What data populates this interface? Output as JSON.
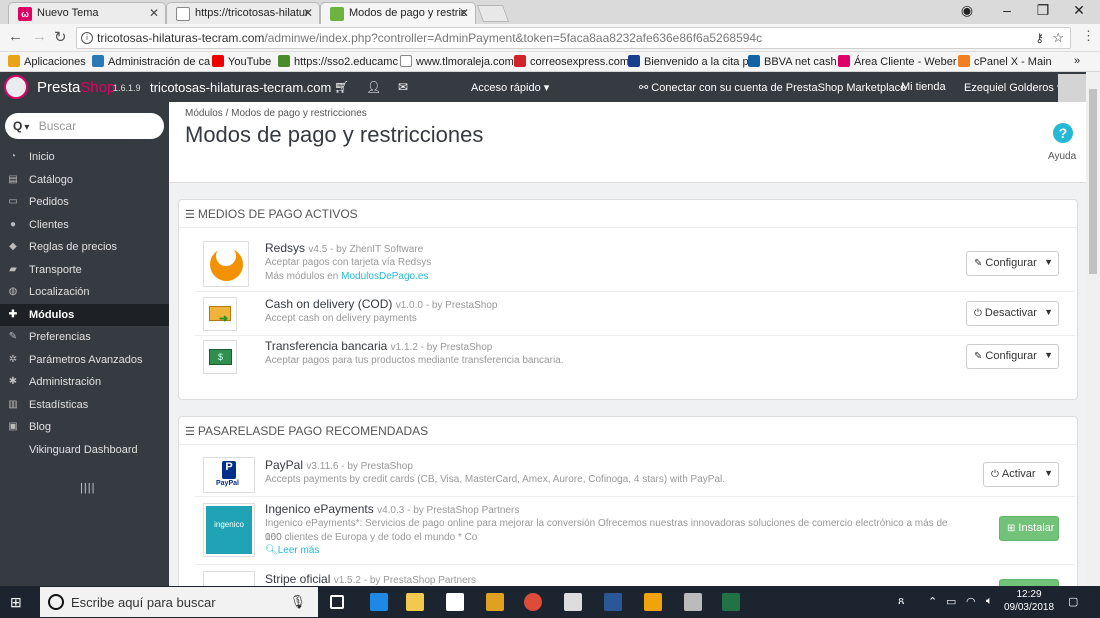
{
  "browser": {
    "tabs": [
      {
        "title": "Nuevo Tema",
        "favicon_color": "#df0067"
      },
      {
        "title": "https://tricotosas-hilatur",
        "favicon_color": "#ffffff"
      },
      {
        "title": "Modos de pago y restric",
        "favicon_color": "#6cb33f"
      }
    ],
    "url_main": "tricotosas-hilaturas-tecram.com",
    "url_rest": "/adminwe/index.php?controller=AdminPayment&token=5faca8aa8232afe636e86f6a5268594c",
    "bookmarks": [
      "Aplicaciones",
      "Administración de ca",
      "YouTube",
      "https://sso2.educamc",
      "www.tlmoraleja.com",
      "correosexpress.com",
      "Bienvenido a la cita p",
      "BBVA net cash",
      "Área Cliente - Weber",
      "cPanel X - Main"
    ]
  },
  "header": {
    "brand_presta": "Presta",
    "brand_shop": "Shop",
    "version": "1.6.1.9",
    "shop_name": "tricotosas-hilaturas-tecram.com",
    "quick_access": "Acceso rápido ▾",
    "connect": "Conectar con su cuenta de PrestaShop Marketplace",
    "my_shop": "Mi tienda",
    "user": "Ezequiel Golderos ▾"
  },
  "sidebar": {
    "search_placeholder": "Buscar",
    "items": [
      {
        "label": "Inicio",
        "icon": "dashboard-icon",
        "glyph": "◔"
      },
      {
        "label": "Catálogo",
        "icon": "book-icon",
        "glyph": "▤"
      },
      {
        "label": "Pedidos",
        "icon": "credit-card-icon",
        "glyph": "▭"
      },
      {
        "label": "Clientes",
        "icon": "users-icon",
        "glyph": "●"
      },
      {
        "label": "Reglas de precios",
        "icon": "tags-icon",
        "glyph": "◆"
      },
      {
        "label": "Transporte",
        "icon": "truck-icon",
        "glyph": "▰"
      },
      {
        "label": "Localización",
        "icon": "globe-icon",
        "glyph": "◍"
      },
      {
        "label": "Módulos",
        "icon": "puzzle-icon",
        "glyph": "✚"
      },
      {
        "label": "Preferencias",
        "icon": "wrench-icon",
        "glyph": "✎"
      },
      {
        "label": "Parámetros Avanzados",
        "icon": "cogs-icon",
        "glyph": "✲"
      },
      {
        "label": "Administración",
        "icon": "cog-icon",
        "glyph": "✱"
      },
      {
        "label": "Estadísticas",
        "icon": "bar-chart-icon",
        "glyph": "▥"
      },
      {
        "label": "Blog",
        "icon": "edit-icon",
        "glyph": "▣"
      },
      {
        "label": "Vikinguard Dashboard",
        "icon": "",
        "glyph": ""
      }
    ],
    "active_index": 7,
    "collapse": "||||"
  },
  "page": {
    "breadcrumb": "Módulos  /  Modos de pago y restricciones",
    "title": "Modos de pago y restricciones",
    "help_label": "Ayuda"
  },
  "active_panel": {
    "title": "MEDIOS DE PAGO ACTIVOS",
    "modules": [
      {
        "name": "Redsys",
        "meta": "v4.5 - by ZhenIT Software",
        "desc": "Aceptar pagos con tarjeta vía Redsys",
        "extra": "Más módulos en",
        "extra_link": "ModulosDePago.es",
        "button": "Configurar",
        "button_icon": "wrench-icon"
      },
      {
        "name": "Cash on delivery (COD)",
        "meta": "v1.0.0 - by PrestaShop",
        "desc": "Accept cash on delivery payments",
        "button": "Desactivar",
        "button_icon": "power-icon"
      },
      {
        "name": "Transferencia bancaria",
        "meta": "v1.1.2 - by PrestaShop",
        "desc": "Aceptar pagos para tus productos mediante transferencia bancaria.",
        "button": "Configurar",
        "button_icon": "wrench-icon"
      }
    ]
  },
  "recommended_panel": {
    "title": "PASARELASDE PAGO RECOMENDADAS",
    "modules": [
      {
        "name": "PayPal",
        "meta": "v3.11.6 - by PrestaShop",
        "desc": "Accepts payments by credit cards (CB, Visa, MasterCard, Amex, Aurore, Cofinoga, 4 stars) with PayPal.",
        "button": "Activar",
        "button_icon": "power-icon"
      },
      {
        "name": "Ingenico ePayments",
        "meta": "v4.0.3 - by PrestaShop Partners",
        "desc1": "Ingenico ePayments*: Servicios de pago online para mejorar la conversión Ofrecemos nuestras innovadoras soluciones de comercio electrónico a más de 160",
        "desc2": "000 clientes de Europa y de todo el mundo * Co",
        "more": "Leer más",
        "button": "Instalar",
        "button_icon": "plus-icon"
      },
      {
        "name": "Stripe oficial",
        "meta": "v1.5.2 - by PrestaShop Partners"
      }
    ]
  },
  "taskbar": {
    "search_placeholder": "Escribe aquí para buscar",
    "time": "12:29",
    "date": "09/03/2018"
  }
}
